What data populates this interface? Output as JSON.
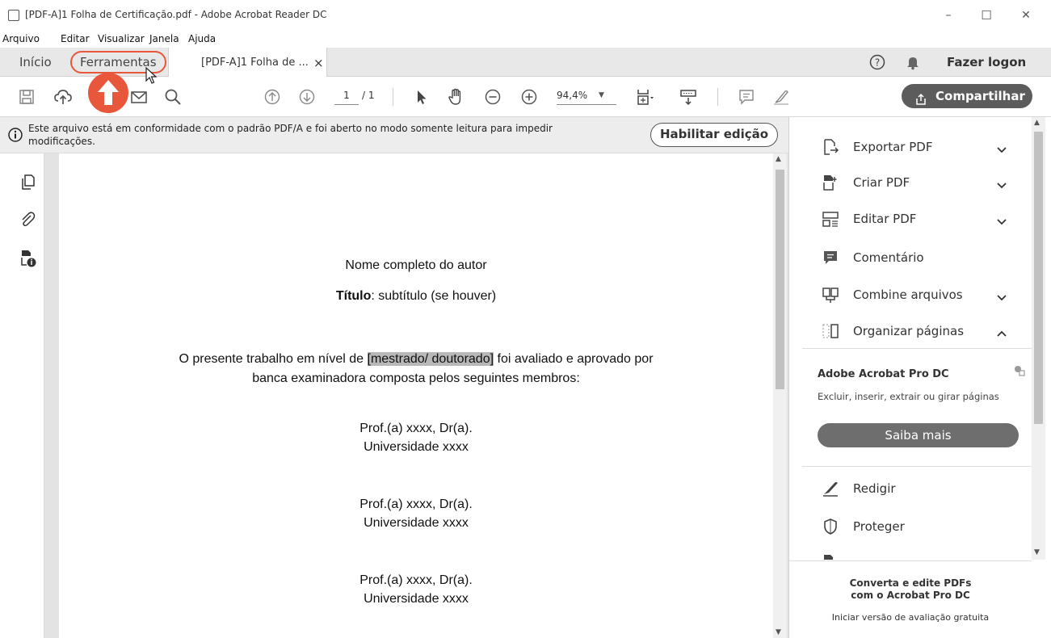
{
  "window": {
    "title": "[PDF-A]1 Folha de Certificação.pdf - Adobe Acrobat Reader DC",
    "minimize": "–",
    "maximize": "☐",
    "close": "✕"
  },
  "menu": [
    "Arquivo",
    "Editar",
    "Visualizar",
    "Janela",
    "Ajuda"
  ],
  "tabs": {
    "home": "Início",
    "tools": "Ferramentas",
    "document": "[PDF-A]1 Folha de ...",
    "document_close": "×",
    "login": "Fazer logon"
  },
  "toolbar": {
    "page_current": "1",
    "page_total": "/ 1",
    "zoom": "94,4%",
    "share": "Compartilhar"
  },
  "banner": {
    "message": "Este arquivo está em conformidade com o padrão PDF/A e foi aberto no modo somente leitura para impedir modificações.",
    "enable_edit": "Habilitar edição"
  },
  "document": {
    "author": "Nome completo do autor",
    "title_bold": "Título",
    "title_rest": ": subtítulo (se houver)",
    "para_line1_pre": "O presente trabalho em nível de ",
    "para_line1_hl": "[mestrado/ doutorado]",
    "para_line1_post": " foi avaliado e aprovado por",
    "para_line2": "banca examinadora composta pelos seguintes membros:",
    "members": [
      {
        "name": "Prof.(a) xxxx, Dr(a).",
        "university": "Universidade xxxx"
      },
      {
        "name": "Prof.(a) xxxx, Dr(a).",
        "university": "Universidade xxxx"
      },
      {
        "name": "Prof.(a)  xxxx, Dr(a).",
        "university": "Universidade xxxx"
      }
    ]
  },
  "rightpanel": {
    "tools": [
      {
        "label": "Exportar PDF",
        "icon": "export-pdf-icon",
        "chevron": "down"
      },
      {
        "label": "Criar PDF",
        "icon": "create-pdf-icon",
        "chevron": "down"
      },
      {
        "label": "Editar PDF",
        "icon": "edit-pdf-icon",
        "chevron": "down"
      },
      {
        "label": "Comentário",
        "icon": "comment-icon",
        "chevron": ""
      },
      {
        "label": "Combine arquivos",
        "icon": "combine-files-icon",
        "chevron": "down"
      },
      {
        "label": "Organizar páginas",
        "icon": "organize-pages-icon",
        "chevron": "up"
      }
    ],
    "promo": {
      "title": "Adobe Acrobat Pro DC",
      "text": "Excluir, inserir, extrair ou girar páginas",
      "button": "Saiba mais"
    },
    "more_tools": [
      {
        "label": "Redigir",
        "icon": "redact-icon"
      },
      {
        "label": "Proteger",
        "icon": "protect-icon"
      }
    ],
    "footer": {
      "line1": "Converta e edite PDFs",
      "line2": "com o Acrobat Pro DC",
      "link": "Iniciar versão de avaliação gratuita"
    }
  },
  "colors": {
    "accent": "#e8573c",
    "share_button": "#5c5c5c",
    "tab_bar": "#e8e8e8",
    "banner": "#ededed"
  }
}
